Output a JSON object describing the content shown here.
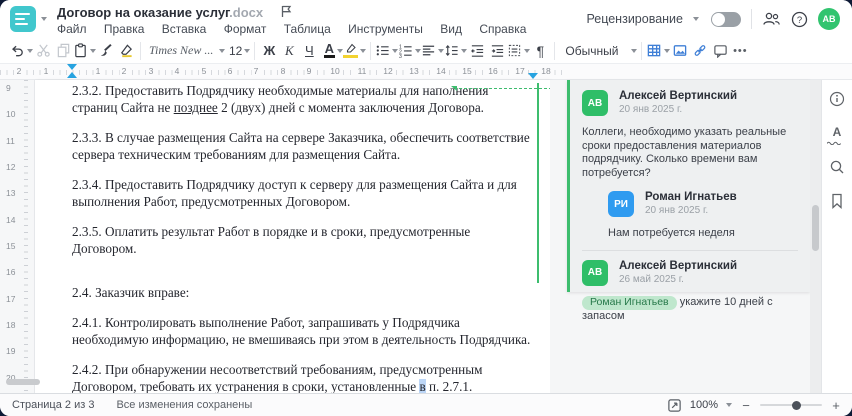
{
  "header": {
    "title": "Договор на оказание услуг",
    "title_ext": ".docx",
    "menu": [
      "Файл",
      "Правка",
      "Вставка",
      "Формат",
      "Таблица",
      "Инструменты",
      "Вид",
      "Справка"
    ],
    "review_label": "Рецензирование",
    "avatar_initials": "АВ",
    "icon_names": [
      "main-menu-logo",
      "flag-icon",
      "collaboration-users-icon",
      "help-icon"
    ]
  },
  "toolbar": {
    "font_name": "Times New ...",
    "font_size": "12",
    "bold_letter": "Ж",
    "italic_letter": "К",
    "underline_letter": "Ч",
    "font_color_letter": "А",
    "pilcrow": "¶",
    "style_name": "Обычный",
    "more_dots": "•••",
    "icon_names": [
      "undo-icon",
      "cut-icon",
      "copy-icon",
      "paste-icon",
      "format-painter-icon",
      "clear-style-icon",
      "bullet-list-icon",
      "numbered-list-icon",
      "align-left-icon",
      "line-spacing-icon",
      "decrease-indent-icon",
      "increase-indent-icon",
      "paragraph-borders-icon",
      "table-icon",
      "image-icon",
      "link-icon",
      "comment-icon",
      "more-icon"
    ]
  },
  "ruler": {
    "h_numbers": [
      "2",
      "1",
      "1",
      "2",
      "3",
      "4",
      "5",
      "6",
      "7",
      "8",
      "9",
      "10",
      "11",
      "12",
      "13",
      "14",
      "15",
      "16",
      "17",
      "18"
    ],
    "v_numbers": [
      "9",
      "10",
      "11",
      "12",
      "13",
      "14",
      "15",
      "16",
      "17",
      "18",
      "19",
      "20"
    ]
  },
  "document": {
    "p_2_3_2": {
      "pre": "2.3.2. Предоставить Подрядчику необходимые материалы для наполнения страниц Сайта не",
      "underlined": "позднее",
      "post": "2 (двух) дней с момента заключения Договора."
    },
    "p_2_3_3": "2.3.3. В случае размещения Сайта на сервере Заказчика, обеспечить соответствие сервера техническим требованиям для размещения Сайта.",
    "p_2_3_4": "2.3.4. Предоставить Подрядчику доступ к серверу для размещения Сайта и для выполнения Работ, предусмотренных Договором.",
    "p_2_3_5": "2.3.5. Оплатить результат Работ в порядке и в сроки, предусмотренные Договором.",
    "p_2_4": "2.4. Заказчик вправе:",
    "p_2_4_1": "2.4.1. Контролировать выполнение Работ, запрашивать у Подрядчика необходимую информацию, не вмешиваясь при этом в деятельность Подрядчика.",
    "p_2_4_2": {
      "pre": "2.4.2. При обнаружении несоответствий требованиям, предусмотренным Договором, требовать их устранения в сроки, установленные",
      "highlighted": "в",
      "post": "п. 2.7.1."
    }
  },
  "comments": {
    "thread1": {
      "author": "Алексей Вертинский",
      "initials": "АВ",
      "date": "20 янв 2025 г.",
      "body": "Коллеги, необходимо указать реальные сроки предоставления материалов подрядчику. Сколько времени вам потребуется?",
      "reply": {
        "author": "Роман Игнатьев",
        "initials": "РИ",
        "date": "20 янв 2025 г.",
        "body": "Нам потребуется неделя"
      }
    },
    "thread2": {
      "author": "Алексей Вертинский",
      "initials": "АВ",
      "date": "26 май 2025 г.",
      "mention": "Роман Игнатьев",
      "body": "укажите 10 дней с запасом"
    }
  },
  "sidebar": {
    "icon_names": [
      "info-icon",
      "spellcheck-icon",
      "search-icon",
      "bookmark-icon"
    ],
    "spellcheck_letter": "А"
  },
  "statusbar": {
    "page_info": "Страница 2 из 3",
    "save_status": "Все изменения сохранены",
    "zoom_value": "100%",
    "zoom_minus": "−",
    "zoom_plus": "+"
  },
  "colors": {
    "logo_teal": "#41c7cd",
    "avatar_green": "#31c46f",
    "comment_blue": "#2f9bf0",
    "comment_anchor_green": "#3dbd6e",
    "toolbar_blue": "#3f7fd6",
    "ruler_marker_blue": "#27a3e0"
  }
}
